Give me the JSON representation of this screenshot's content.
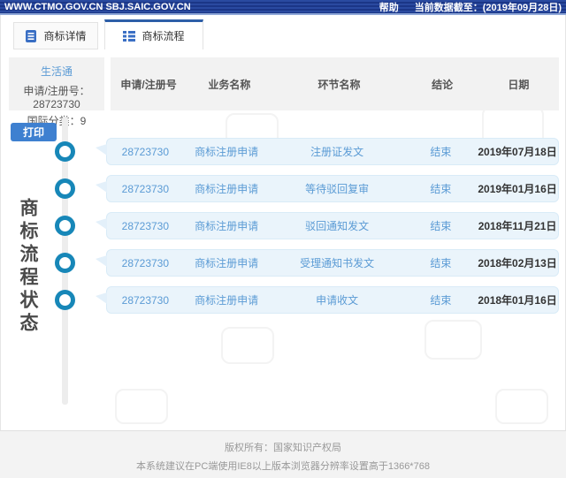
{
  "topbar": {
    "site": "WWW.CTMO.GOV.CN SBJ.SAIC.GOV.CN",
    "help": "帮助",
    "data_cutoff": "当前数据截至：(2019年09月28日)"
  },
  "tabs": [
    {
      "label": "商标详情",
      "icon": "document-icon",
      "active": false
    },
    {
      "label": "商标流程",
      "icon": "list-icon",
      "active": true
    }
  ],
  "info_panel": {
    "trademark_name": "生活通",
    "reg_no_line": "申请/注册号：28723730",
    "class_line": "国际分类：9"
  },
  "print_button_label": "打印",
  "vertical_title": "商标流程状态",
  "table": {
    "headers": [
      "申请/注册号",
      "业务名称",
      "环节名称",
      "结论",
      "日期"
    ],
    "rows": [
      [
        "28723730",
        "商标注册申请",
        "注册证发文",
        "结束",
        "2019年07月18日"
      ],
      [
        "28723730",
        "商标注册申请",
        "等待驳回复审",
        "结束",
        "2019年01月16日"
      ],
      [
        "28723730",
        "商标注册申请",
        "驳回通知发文",
        "结束",
        "2018年11月21日"
      ],
      [
        "28723730",
        "商标注册申请",
        "受理通知书发文",
        "结束",
        "2018年02月13日"
      ],
      [
        "28723730",
        "商标注册申请",
        "申请收文",
        "结束",
        "2018年01月16日"
      ]
    ]
  },
  "footer": {
    "line1": "版权所有：国家知识产权局",
    "line2": "本系统建议在PC端使用IE8以上版本浏览器分辨率设置高于1366*768"
  },
  "colors": {
    "topbar_navy": "#1b3687",
    "tab_active_border": "#2d5fa8",
    "link_blue": "#5b9bd5",
    "timeline_node_teal": "#1787b8",
    "row_background": "#eaf4fb",
    "button_blue": "#3e80d0",
    "panel_gray": "#f2f2f2",
    "footer_gray": "#f3f3f3"
  }
}
